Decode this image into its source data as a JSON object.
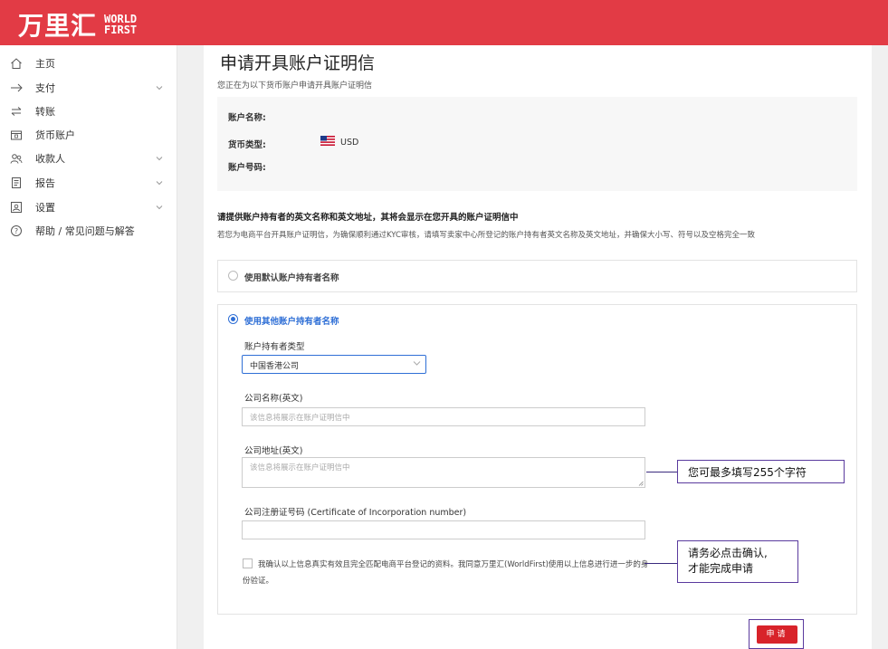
{
  "brand": {
    "name_cn": "万里汇",
    "name_en_line1": "WORLD",
    "name_en_line2": "FIRST",
    "accent": "#e23b45"
  },
  "sidebar": {
    "items": [
      {
        "label": "主页",
        "icon": "home-icon",
        "expandable": false
      },
      {
        "label": "支付",
        "icon": "arrow-right-icon",
        "expandable": true
      },
      {
        "label": "转账",
        "icon": "transfer-icon",
        "expandable": false
      },
      {
        "label": "货币账户",
        "icon": "wallet-icon",
        "expandable": false
      },
      {
        "label": "收款人",
        "icon": "users-icon",
        "expandable": true
      },
      {
        "label": "报告",
        "icon": "document-icon",
        "expandable": true
      },
      {
        "label": "设置",
        "icon": "settings-icon",
        "expandable": true
      },
      {
        "label": "帮助 / 常见问题与解答",
        "icon": "help-icon",
        "expandable": false
      }
    ]
  },
  "page": {
    "title": "申请开具账户证明信",
    "subtitle": "您正在为以下货币账户申请开具账户证明信"
  },
  "account_info": {
    "name_label": "账户名称:",
    "currency_label": "货币类型:",
    "currency_value": "USD",
    "number_label": "账户号码:"
  },
  "section": {
    "title": "请提供账户持有者的英文名称和英文地址，其将会显示在您开具的账户证明信中",
    "description": "若您为电商平台开具账户证明信，为确保顺利通过KYC审核，请填写卖家中心所登记的账户持有者英文名称及英文地址，并确保大小写、符号以及空格完全一致"
  },
  "options": {
    "default_label": "使用默认账户持有者名称",
    "other_label": "使用其他账户持有者名称"
  },
  "form": {
    "holder_type_label": "账户持有者类型",
    "holder_type_value": "中国香港公司",
    "company_name_label": "公司名称(英文)",
    "company_name_placeholder": "该信息将展示在账户证明信中",
    "company_address_label": "公司地址(英文)",
    "company_address_placeholder": "该信息将展示在账户证明信中",
    "reg_number_label": "公司注册证号码 (Certificate of Incorporation number)",
    "reg_number_placeholder": "",
    "agree_text": "我确认以上信息真实有效且完全匹配电商平台登记的资料。我同意万里汇(WorldFirst)使用以上信息进行进一步的身份验证。",
    "submit_label": "申请"
  },
  "annotations": {
    "max_chars": "您可最多填写255个字符",
    "confirm_line1": "请务必点击确认,",
    "confirm_line2": "才能完成申请"
  }
}
